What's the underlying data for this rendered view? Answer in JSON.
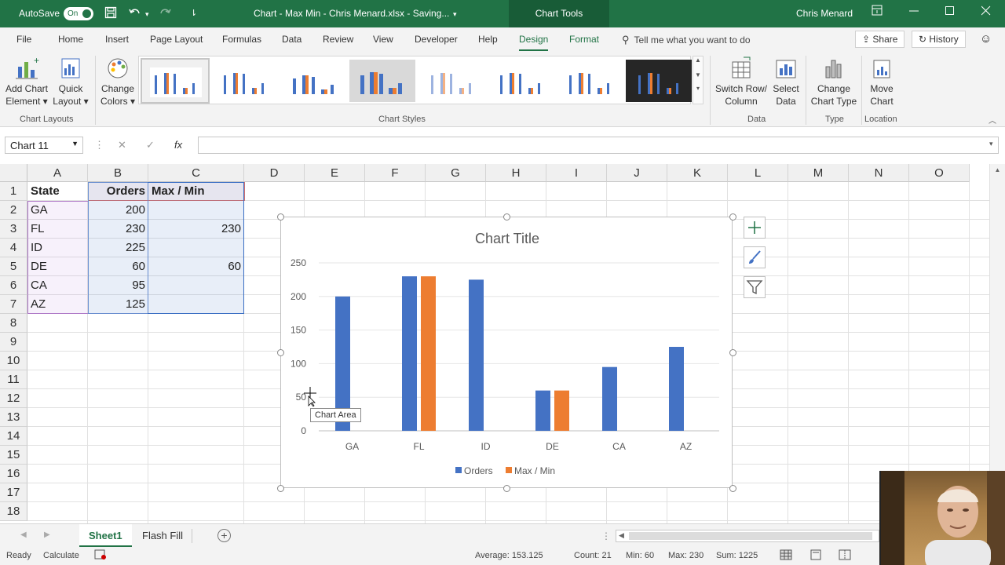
{
  "titlebar": {
    "autosave_label": "AutoSave",
    "autosave_state": "On",
    "doc_title": "Chart - Max Min - Chris Menard.xlsx  -  Saving...",
    "context": "Chart Tools",
    "user": "Chris Menard"
  },
  "tabs": {
    "items": [
      "File",
      "Home",
      "Insert",
      "Page Layout",
      "Formulas",
      "Data",
      "Review",
      "View",
      "Developer",
      "Help",
      "Design",
      "Format"
    ],
    "active": "Design",
    "tellme": "Tell me what you want to do",
    "share": "Share",
    "history": "History"
  },
  "ribbon": {
    "add_chart_element": [
      "Add Chart",
      "Element"
    ],
    "quick_layout": [
      "Quick",
      "Layout"
    ],
    "change_colors": [
      "Change",
      "Colors"
    ],
    "switch_row_col": [
      "Switch Row/",
      "Column"
    ],
    "select_data": [
      "Select",
      "Data"
    ],
    "change_chart_type": [
      "Change",
      "Chart Type"
    ],
    "move_chart": [
      "Move",
      "Chart"
    ],
    "groups": {
      "chart_layouts": "Chart Layouts",
      "chart_styles": "Chart Styles",
      "data": "Data",
      "type": "Type",
      "location": "Location"
    }
  },
  "formula_bar": {
    "name_box": "Chart 11",
    "cancel": "✕",
    "enter": "✓",
    "fx": "fx",
    "value": ""
  },
  "sheet": {
    "columns": [
      "A",
      "B",
      "C",
      "D",
      "E",
      "F",
      "G",
      "H",
      "I",
      "J",
      "K",
      "L",
      "M",
      "N",
      "O"
    ],
    "rows": [
      "1",
      "2",
      "3",
      "4",
      "5",
      "6",
      "7",
      "8",
      "9",
      "10",
      "11",
      "12",
      "13",
      "14",
      "15",
      "16",
      "17",
      "18"
    ],
    "headers": [
      "State",
      "Orders",
      "Max / Min"
    ],
    "data": [
      [
        "GA",
        "200",
        ""
      ],
      [
        "FL",
        "230",
        "230"
      ],
      [
        "ID",
        "225",
        ""
      ],
      [
        "DE",
        "60",
        "60"
      ],
      [
        "CA",
        "95",
        ""
      ],
      [
        "AZ",
        "125",
        ""
      ]
    ]
  },
  "chart_data": {
    "type": "bar",
    "title": "Chart Title",
    "categories": [
      "GA",
      "FL",
      "ID",
      "DE",
      "CA",
      "AZ"
    ],
    "series": [
      {
        "name": "Orders",
        "values": [
          200,
          230,
          225,
          60,
          95,
          125
        ],
        "color": "#4472C4"
      },
      {
        "name": "Max / Min",
        "values": [
          null,
          230,
          null,
          60,
          null,
          null
        ],
        "color": "#ED7D31"
      }
    ],
    "ylim": [
      0,
      250
    ],
    "yticks": [
      "0",
      "50",
      "100",
      "150",
      "200",
      "250"
    ],
    "grid": true,
    "legend": "bottom"
  },
  "tooltip": "Chart Area",
  "sheet_tabs": [
    "Sheet1",
    "Flash Fill"
  ],
  "active_sheet": "Sheet1",
  "status": {
    "ready": "Ready",
    "calculate": "Calculate",
    "average": "Average: 153.125",
    "count": "Count: 21",
    "min": "Min: 60",
    "max": "Max: 230",
    "sum": "Sum: 1225"
  },
  "colors": {
    "excel_green": "#217346",
    "orders": "#4472C4",
    "maxmin": "#ED7D31"
  }
}
